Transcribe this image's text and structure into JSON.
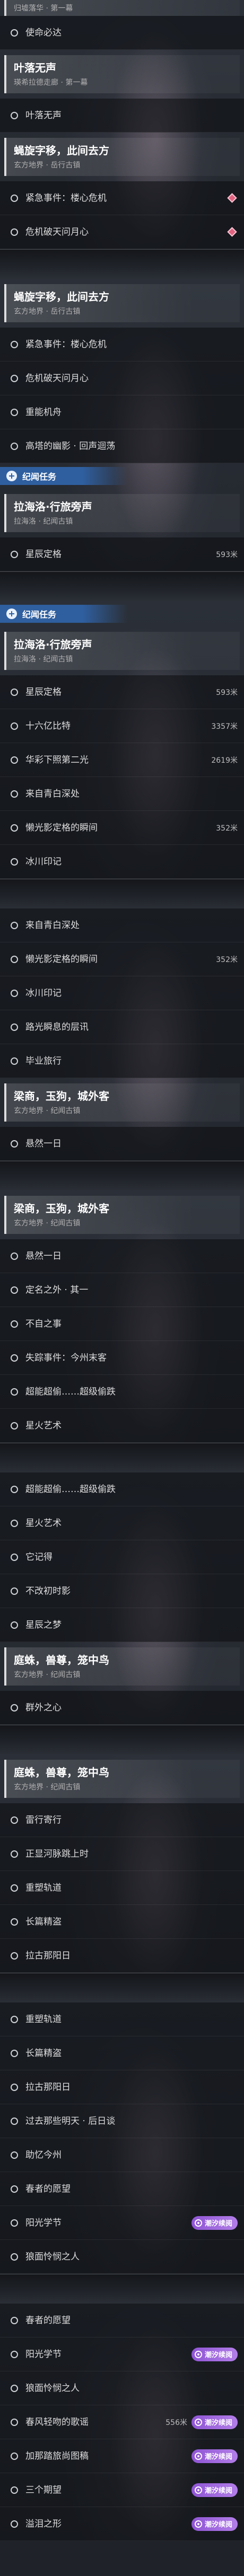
{
  "colors": {
    "category_header": "#2f5f9f",
    "tide_badge": "#8f55d4",
    "marker": "#e0637f"
  },
  "segments": [
    {
      "rows": [
        {
          "cut_subtitle": "归墟落华 · 第一幕"
        },
        {
          "label": "使命必达"
        },
        {
          "title": "叶落无声",
          "subtitle": "瑛希拉德走廊 · 第一幕"
        },
        {
          "label": "叶落无声"
        },
        {
          "title": "蝇旋字移，此间去方",
          "subtitle": "玄方地界 · 岳行古镇"
        },
        {
          "label": "紧急事件：楼心危机",
          "marker": "diamond-marker-icon"
        },
        {
          "label": "危机破天问月心",
          "marker": "diamond-marker-icon"
        }
      ]
    },
    {
      "rows": [
        {
          "title": "蝇旋字移，此间去方",
          "subtitle": "玄方地界 · 岳行古镇"
        },
        {
          "label": "紧急事件：楼心危机"
        },
        {
          "label": "危机破天问月心"
        },
        {
          "label": "重能机舟"
        },
        {
          "label": "高塔的幽影 · 回声迴荡"
        },
        {
          "section": "纪闻任务"
        },
        {
          "title": "拉海洛·行旅旁声",
          "subtitle": "拉海洛 · 纪闻古镇"
        },
        {
          "label": "星辰定格",
          "distance": "593米"
        }
      ]
    },
    {
      "rows": [
        {
          "section": "纪闻任务"
        },
        {
          "title": "拉海洛·行旅旁声",
          "subtitle": "拉海洛 · 纪闻古镇"
        },
        {
          "label": "星辰定格",
          "distance": "593米"
        },
        {
          "label": "十六亿比特",
          "distance": "3357米"
        },
        {
          "label": "华彩下照第二光",
          "distance": "2619米"
        },
        {
          "label": "来自青白深处"
        },
        {
          "label": "懒光影定格的瞬间",
          "distance": "352米"
        },
        {
          "label": "冰川印记"
        }
      ]
    },
    {
      "rows": [
        {
          "label": "来自青白深处"
        },
        {
          "label": "懒光影定格的瞬间",
          "distance": "352米"
        },
        {
          "label": "冰川印记"
        },
        {
          "label": "路光瞬息的层讯"
        },
        {
          "label": "毕业旅行"
        },
        {
          "title": "梁商，玉狗，城外客",
          "subtitle": "玄方地界 · 纪闻古镇"
        },
        {
          "label": "悬然一日"
        }
      ]
    },
    {
      "rows": [
        {
          "title": "梁商，玉狗，城外客",
          "subtitle": "玄方地界 · 纪闻古镇"
        },
        {
          "label": "悬然一日"
        },
        {
          "label": "定名之外 · 其一"
        },
        {
          "label": "不自之事"
        },
        {
          "label": "失踪事件：今州末客"
        },
        {
          "label": "超能超偷……超级偷跌"
        },
        {
          "label": "星火艺术"
        }
      ]
    },
    {
      "rows": [
        {
          "label": "超能超偷……超级偷跌"
        },
        {
          "label": "星火艺术"
        },
        {
          "label": "它记得"
        },
        {
          "label": "不改初时影"
        },
        {
          "label": "星辰之梦"
        },
        {
          "title": "庭蛛，兽尊，笼中鸟",
          "subtitle": "玄方地界 · 纪闻古镇"
        },
        {
          "label": "群外之心"
        }
      ]
    },
    {
      "rows": [
        {
          "title": "庭蛛，兽尊，笼中鸟",
          "subtitle": "玄方地界 · 纪闻古镇"
        },
        {
          "label": "雷行寄行"
        },
        {
          "label": "正显河脉跳上时"
        },
        {
          "label": "重塑轨道"
        },
        {
          "label": "长篇精盗"
        },
        {
          "label": "拉古那阳日"
        }
      ]
    },
    {
      "rows": [
        {
          "label": "重塑轨道"
        },
        {
          "label": "长篇精盗"
        },
        {
          "label": "拉古那阳日"
        },
        {
          "label": "过去那些明天 · 后日谈"
        },
        {
          "label": "助忆今州"
        },
        {
          "label": "春者的愿望"
        },
        {
          "label": "阳光学节",
          "badge": "潮汐续阅"
        },
        {
          "label": "狼面怜悯之人"
        }
      ]
    },
    {
      "rows": [
        {
          "label": "春者的愿望"
        },
        {
          "label": "阳光学节",
          "badge": "潮汐续阅"
        },
        {
          "label": "狼面怜悯之人"
        },
        {
          "label": "春风轻吻的歌谣",
          "distance": "556米",
          "badge": "潮汐续阅"
        },
        {
          "label": "加那踏旅尚图稿",
          "badge": "潮汐续阅"
        },
        {
          "label": "三个期望",
          "badge": "潮汐续阅"
        },
        {
          "label": "溢泪之形",
          "badge": "潮汐续阅"
        }
      ]
    }
  ]
}
